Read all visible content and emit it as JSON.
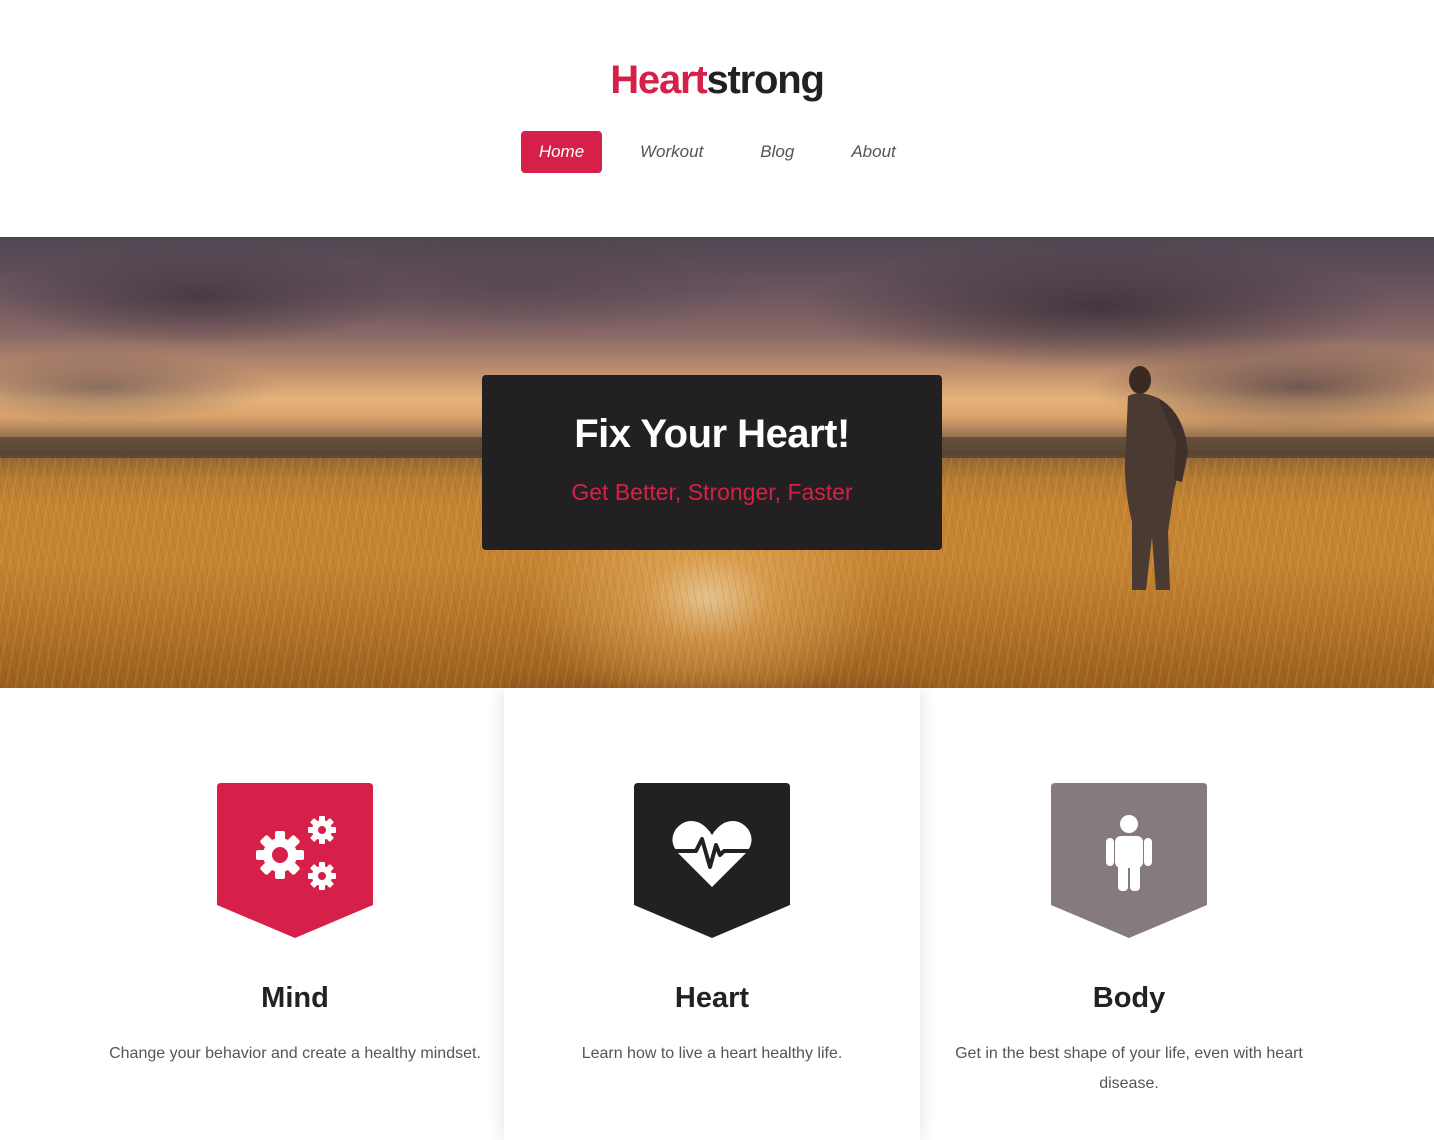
{
  "brand": {
    "accent_part": "Heart",
    "dark_part": "strong"
  },
  "colors": {
    "accent": "#d6204a",
    "dark": "#232021",
    "gray": "#857b7c"
  },
  "nav": {
    "items": [
      {
        "label": "Home",
        "active": true
      },
      {
        "label": "Workout",
        "active": false
      },
      {
        "label": "Blog",
        "active": false
      },
      {
        "label": "About",
        "active": false
      }
    ]
  },
  "hero": {
    "title": "Fix Your Heart!",
    "subtitle": "Get Better, Stronger, Faster"
  },
  "features": [
    {
      "title": "Mind",
      "description": "Change your behavior and create a healthy mindset.",
      "icon": "gears-icon",
      "color": "#d6204a"
    },
    {
      "title": "Heart",
      "description": "Learn how to live a heart healthy life.",
      "icon": "heartbeat-icon",
      "color": "#232021"
    },
    {
      "title": "Body",
      "description": "Get in the best shape of your life, even with heart disease.",
      "icon": "person-icon",
      "color": "#857b7c"
    }
  ]
}
